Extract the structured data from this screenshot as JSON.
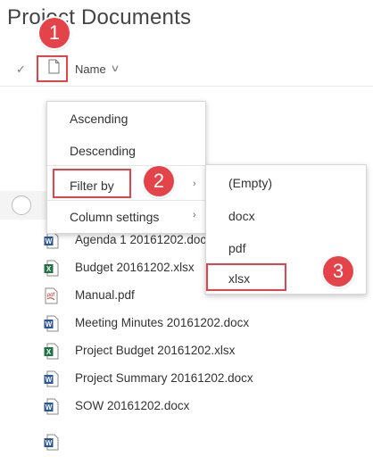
{
  "page": {
    "title": "Project Documents"
  },
  "header": {
    "check_glyph": "✓",
    "column_name": "Name",
    "chevron": "∨"
  },
  "annotations": {
    "step1": "1",
    "step2": "2",
    "step3": "3"
  },
  "sort_menu": {
    "ascending": "Ascending",
    "descending": "Descending",
    "filter_by": "Filter by",
    "column_settings": "Column settings",
    "submenu_chevron": "›"
  },
  "filter_menu": {
    "options": [
      "(Empty)",
      "docx",
      "pdf",
      "xlsx"
    ]
  },
  "files": [
    {
      "name": "Agenda 1 20161202.docx",
      "type": "docx"
    },
    {
      "name": "Budget 20161202.xlsx",
      "type": "xlsx"
    },
    {
      "name": "Manual.pdf",
      "type": "pdf"
    },
    {
      "name": "Meeting Minutes 20161202.docx",
      "type": "docx"
    },
    {
      "name": "Project Budget 20161202.xlsx",
      "type": "xlsx"
    },
    {
      "name": "Project Summary 20161202.docx",
      "type": "docx"
    },
    {
      "name": "SOW 20161202.docx",
      "type": "docx"
    }
  ],
  "icon_labels": {
    "word": "W",
    "excel": "X",
    "pdf": "pdf"
  },
  "colors": {
    "annotation_red": "#e5434a",
    "word_blue": "#2b579a",
    "excel_green": "#217346",
    "pdf_red": "#c8312b"
  }
}
